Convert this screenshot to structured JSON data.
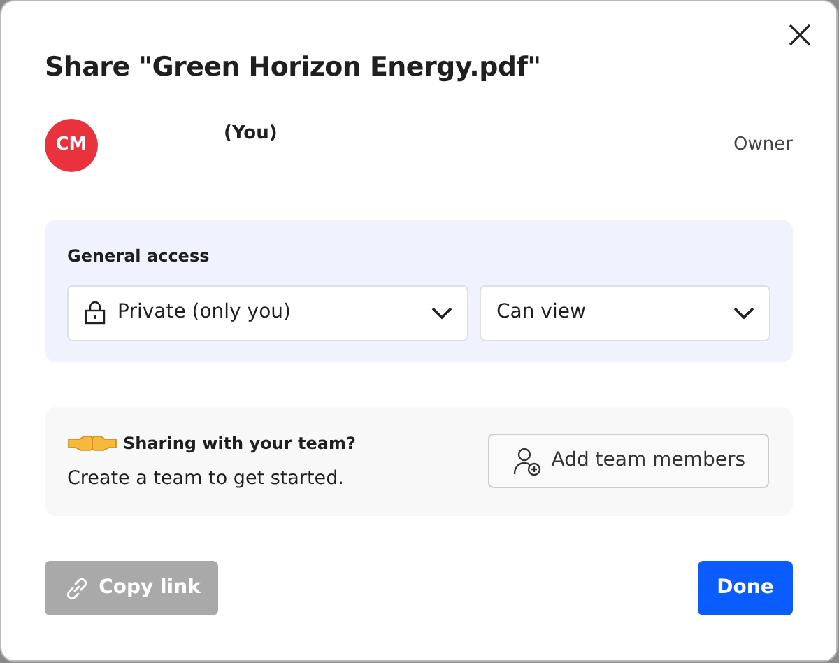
{
  "dialog": {
    "title": "Share \"Green Horizon Energy.pdf\""
  },
  "members": [
    {
      "initials": "CM",
      "color": "#e8323c",
      "name": "(You)",
      "role": "Owner"
    }
  ],
  "general_access": {
    "heading": "General access",
    "access": "Private (only you)",
    "permission": "Can view"
  },
  "team_prompt": {
    "heading": "Sharing with your team?",
    "text": "Create a team to get started.",
    "button": "Add team members"
  },
  "footer": {
    "copy_link": {
      "label": "Copy link",
      "disabled": true
    },
    "done": {
      "label": "Done",
      "disabled": false
    }
  }
}
